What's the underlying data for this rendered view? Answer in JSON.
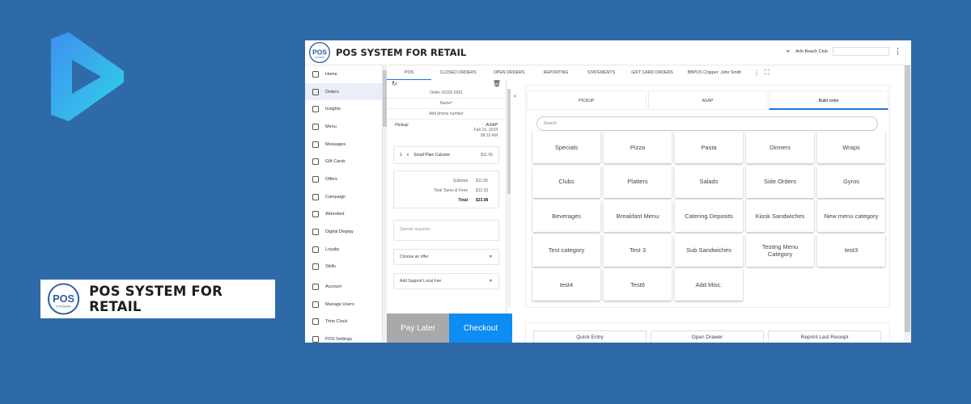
{
  "brand": {
    "badge_text": "POS",
    "badge_sub": "SYSTEMS",
    "name": "POS SYSTEM FOR RETAIL"
  },
  "colors": {
    "background": "#2f6aa8",
    "accent": "#1a73e8",
    "checkout": "#0d8cf2",
    "pay_later": "#a9a9a9"
  },
  "app": {
    "title": "POS SYSTEM FOR RETAIL",
    "location": "Arlo Beach Club",
    "more_icon": "vertical-dots-icon"
  },
  "sidebar": {
    "items": [
      {
        "label": "Home",
        "icon": "home-icon"
      },
      {
        "label": "Orders",
        "icon": "bag-icon"
      },
      {
        "label": "Insights",
        "icon": "chart-icon"
      },
      {
        "label": "Menu",
        "icon": "utensils-icon"
      },
      {
        "label": "Messages",
        "icon": "chat-icon"
      },
      {
        "label": "Gift Cards",
        "icon": "gift-icon"
      },
      {
        "label": "Offers",
        "icon": "tag-icon"
      },
      {
        "label": "Campaign",
        "icon": "campaign-icon"
      },
      {
        "label": "Attendant",
        "icon": "phone-icon"
      },
      {
        "label": "Digital Display",
        "icon": "monitor-icon"
      },
      {
        "label": "Loyalty",
        "icon": "smile-icon"
      },
      {
        "label": "Skills",
        "icon": "skills-icon"
      },
      {
        "label": "Account",
        "icon": "gear-icon"
      },
      {
        "label": "Manage Users",
        "icon": "users-icon"
      },
      {
        "label": "Time Clock",
        "icon": "clock-icon"
      },
      {
        "label": "POS Settings",
        "icon": "settings-icon"
      }
    ],
    "active_index": 1
  },
  "tabs": [
    "POS",
    "CLOSED ORDERS",
    "OPEN ORDERS",
    "REPORTING",
    "STATEMENTS",
    "GIFT CARD ORDERS",
    "BBPOS Chipper: John Smith"
  ],
  "active_tab": 0,
  "order": {
    "number": "Order #2302 0991",
    "name_placeholder": "Name*",
    "phone_placeholder": "Add phone number",
    "type": "Pickup",
    "timing": "ASAP",
    "date": "Feb 16, 2023",
    "time": "08:15 AM",
    "item": {
      "qty": "1",
      "name": "Small Plain Calzone",
      "price": "$11.65"
    },
    "subtotal_label": "Subtotal",
    "subtotal": "$11.65",
    "taxes_label": "Total Taxes & Fees",
    "taxes": "$12.33",
    "total_label": "Total",
    "total": "$23.98",
    "special_placeholder": "Special requests...",
    "offer_select": "Choose an offer",
    "support_select": "Add Support Local Fee",
    "pay_later": "Pay Later",
    "checkout": "Checkout"
  },
  "menu": {
    "tabs": [
      "PICKUP",
      "ASAP",
      "Build order"
    ],
    "active_tab": 2,
    "search_placeholder": "Search",
    "categories": [
      "Specials",
      "Pizza",
      "Pasta",
      "Dinners",
      "Wraps",
      "Clubs",
      "Platters",
      "Salads",
      "Side Orders",
      "Gyros",
      "Beverages",
      "Breakfast Menu",
      "Catering Deposits",
      "Kiosk Sandwiches",
      "New menu category",
      "Test category",
      "Test 3",
      "Sub Sandwiches",
      "Testing Menu Category",
      "test3",
      "test4",
      "Test6",
      "Add Misc."
    ]
  },
  "quick_actions": [
    "Quick Entry",
    "Open Drawer",
    "Reprint Last Receipt"
  ]
}
